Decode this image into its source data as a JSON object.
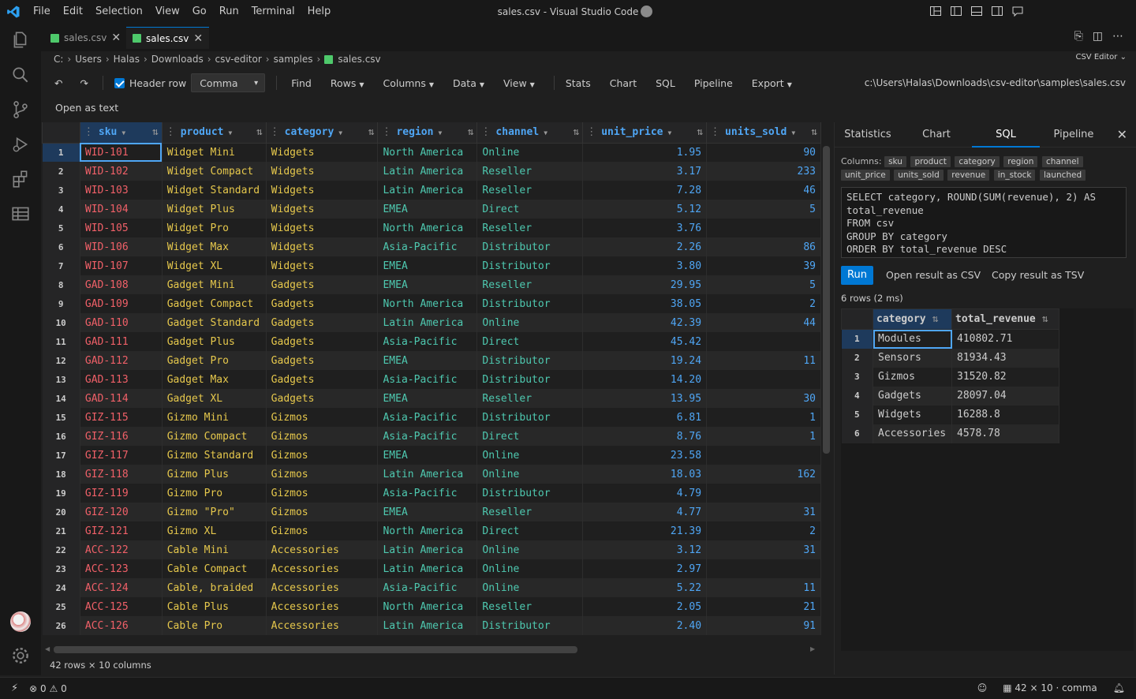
{
  "menu": [
    "File",
    "Edit",
    "Selection",
    "View",
    "Go",
    "Run",
    "Terminal",
    "Help"
  ],
  "window_title": "sales.csv - Visual Studio Code",
  "tabs": [
    {
      "label": "sales.csv",
      "active": false
    },
    {
      "label": "sales.csv",
      "active": true
    }
  ],
  "breadcrumb": [
    "C:",
    "Users",
    "Halas",
    "Downloads",
    "csv-editor",
    "samples",
    "sales.csv"
  ],
  "editor_mode": "CSV Editor",
  "toolbar": {
    "header_row": "Header row",
    "delimiter": "Comma",
    "find": "Find",
    "rows": "Rows",
    "columns": "Columns",
    "data": "Data",
    "view": "View",
    "stats": "Stats",
    "chart": "Chart",
    "sql": "SQL",
    "pipeline": "Pipeline",
    "export": "Export",
    "path": "c:\\Users\\Halas\\Downloads\\csv-editor\\samples\\sales.csv"
  },
  "open_as_text": "Open as text",
  "grid": {
    "columns": [
      "sku",
      "product",
      "category",
      "region",
      "channel",
      "unit_price",
      "units_sold"
    ],
    "rows": [
      [
        "1",
        "WID-101",
        "Widget Mini",
        "Widgets",
        "North America",
        "Online",
        "1.95",
        "90"
      ],
      [
        "2",
        "WID-102",
        "Widget Compact",
        "Widgets",
        "Latin America",
        "Reseller",
        "3.17",
        "233"
      ],
      [
        "3",
        "WID-103",
        "Widget Standard",
        "Widgets",
        "Latin America",
        "Reseller",
        "7.28",
        "46"
      ],
      [
        "4",
        "WID-104",
        "Widget Plus",
        "Widgets",
        "EMEA",
        "Direct",
        "5.12",
        "5"
      ],
      [
        "5",
        "WID-105",
        "Widget Pro",
        "Widgets",
        "North America",
        "Reseller",
        "3.76",
        ""
      ],
      [
        "6",
        "WID-106",
        "Widget Max",
        "Widgets",
        "Asia-Pacific",
        "Distributor",
        "2.26",
        "86"
      ],
      [
        "7",
        "WID-107",
        "Widget XL",
        "Widgets",
        "EMEA",
        "Distributor",
        "3.80",
        "39"
      ],
      [
        "8",
        "GAD-108",
        "Gadget Mini",
        "Gadgets",
        "EMEA",
        "Reseller",
        "29.95",
        "5"
      ],
      [
        "9",
        "GAD-109",
        "Gadget Compact",
        "Gadgets",
        "North America",
        "Distributor",
        "38.05",
        "2"
      ],
      [
        "10",
        "GAD-110",
        "Gadget Standard",
        "Gadgets",
        "Latin America",
        "Online",
        "42.39",
        "44"
      ],
      [
        "11",
        "GAD-111",
        "Gadget Plus",
        "Gadgets",
        "Asia-Pacific",
        "Direct",
        "45.42",
        ""
      ],
      [
        "12",
        "GAD-112",
        "Gadget Pro",
        "Gadgets",
        "EMEA",
        "Distributor",
        "19.24",
        "11"
      ],
      [
        "13",
        "GAD-113",
        "Gadget Max",
        "Gadgets",
        "Asia-Pacific",
        "Distributor",
        "14.20",
        ""
      ],
      [
        "14",
        "GAD-114",
        "Gadget XL",
        "Gadgets",
        "EMEA",
        "Reseller",
        "13.95",
        "30"
      ],
      [
        "15",
        "GIZ-115",
        "Gizmo Mini",
        "Gizmos",
        "Asia-Pacific",
        "Distributor",
        "6.81",
        "1"
      ],
      [
        "16",
        "GIZ-116",
        "Gizmo Compact",
        "Gizmos",
        "Asia-Pacific",
        "Direct",
        "8.76",
        "1"
      ],
      [
        "17",
        "GIZ-117",
        "Gizmo Standard",
        "Gizmos",
        "EMEA",
        "Online",
        "23.58",
        ""
      ],
      [
        "18",
        "GIZ-118",
        "Gizmo Plus",
        "Gizmos",
        "Latin America",
        "Online",
        "18.03",
        "162"
      ],
      [
        "19",
        "GIZ-119",
        "Gizmo Pro",
        "Gizmos",
        "Asia-Pacific",
        "Distributor",
        "4.79",
        ""
      ],
      [
        "20",
        "GIZ-120",
        "Gizmo \"Pro\"",
        "Gizmos",
        "EMEA",
        "Reseller",
        "4.77",
        "31"
      ],
      [
        "21",
        "GIZ-121",
        "Gizmo XL",
        "Gizmos",
        "North America",
        "Direct",
        "21.39",
        "2"
      ],
      [
        "22",
        "ACC-122",
        "Cable Mini",
        "Accessories",
        "Latin America",
        "Online",
        "3.12",
        "31"
      ],
      [
        "23",
        "ACC-123",
        "Cable Compact",
        "Accessories",
        "Latin America",
        "Online",
        "2.97",
        ""
      ],
      [
        "24",
        "ACC-124",
        "Cable, braided",
        "Accessories",
        "Asia-Pacific",
        "Online",
        "5.22",
        "11"
      ],
      [
        "25",
        "ACC-125",
        "Cable Plus",
        "Accessories",
        "North America",
        "Reseller",
        "2.05",
        "21"
      ],
      [
        "26",
        "ACC-126",
        "Cable Pro",
        "Accessories",
        "Latin America",
        "Distributor",
        "2.40",
        "91"
      ]
    ]
  },
  "grid_status": "42 rows × 10 columns",
  "panel": {
    "tabs": [
      "Statistics",
      "Chart",
      "SQL",
      "Pipeline"
    ],
    "columns_label": "Columns:",
    "column_chips": [
      "sku",
      "product",
      "category",
      "region",
      "channel",
      "unit_price",
      "units_sold",
      "revenue",
      "in_stock",
      "launched"
    ],
    "sql": "SELECT category, ROUND(SUM(revenue), 2) AS total_revenue\nFROM csv\nGROUP BY category\nORDER BY total_revenue DESC",
    "run": "Run",
    "open_csv": "Open result as CSV",
    "copy_tsv": "Copy result as TSV",
    "rows_info": "6 rows (2 ms)",
    "result_columns": [
      "category",
      "total_revenue"
    ],
    "result_rows": [
      [
        "1",
        "Modules",
        "410802.71"
      ],
      [
        "2",
        "Sensors",
        "81934.43"
      ],
      [
        "3",
        "Gizmos",
        "31520.82"
      ],
      [
        "4",
        "Gadgets",
        "28097.04"
      ],
      [
        "5",
        "Widgets",
        "16288.8"
      ],
      [
        "6",
        "Accessories",
        "4578.78"
      ]
    ]
  },
  "statusbar": {
    "errors": "0",
    "warnings": "0",
    "grid_info": "42 × 10 · comma"
  }
}
